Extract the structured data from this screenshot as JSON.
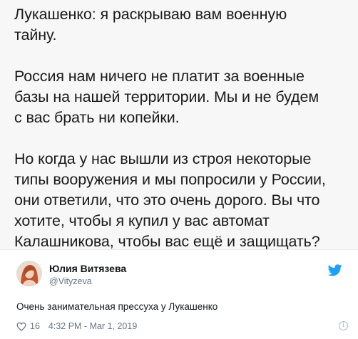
{
  "quote": {
    "text": "Лукашенко: я раскрываю вам военную\nтайну.\n\nРоссия нам ничего не платит за военные\nбазы на нашей территории. Мы и не будем\nс вас брать ни копейки.\n\nНо когда у нас вышли из строя некоторые\nтипы вооружения и мы попросили у России,\nони ответили, что это очень дорого. Вы что\nхотите, чтобы я купил у вас автомат\nКалашникова, чтобы вас ещё и защищать?"
  },
  "tweet": {
    "author_name": "Юлия Витязева",
    "author_handle": "@Vityzeva",
    "text": "Очень занимательная прессуха у Лукашенко",
    "likes": "16",
    "timestamp": "4:32 PM - Mar 1, 2019"
  },
  "icons": {
    "brand": "twitter-icon",
    "like": "heart-icon",
    "info": "info-icon",
    "brand_color": "#1da1f2"
  }
}
